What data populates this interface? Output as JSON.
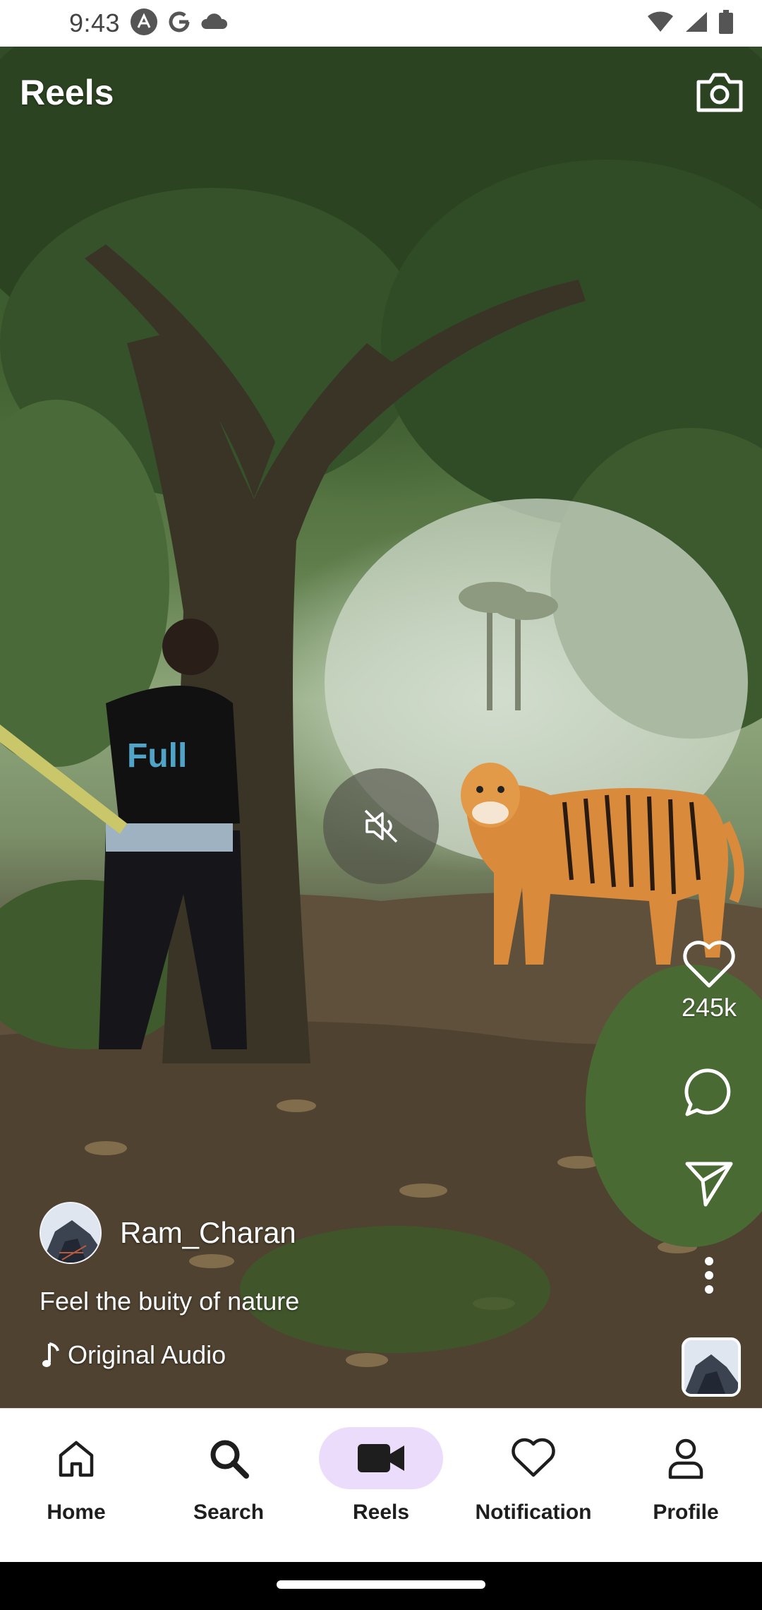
{
  "status_bar": {
    "time": "9:43"
  },
  "header": {
    "title": "Reels"
  },
  "reel": {
    "author": "Ram_Charan",
    "caption": "Feel the buity of nature",
    "audio": "Original Audio",
    "likes": "245k",
    "muted": true
  },
  "nav": {
    "items": [
      {
        "label": "Home",
        "icon": "home-icon"
      },
      {
        "label": "Search",
        "icon": "search-icon"
      },
      {
        "label": "Reels",
        "icon": "video-camera-icon",
        "active": true
      },
      {
        "label": "Notification",
        "icon": "heart-icon"
      },
      {
        "label": "Profile",
        "icon": "person-icon"
      }
    ]
  },
  "colors": {
    "nav_active_bg": "#ecdcfb",
    "nav_text": "#1e1e1e"
  }
}
